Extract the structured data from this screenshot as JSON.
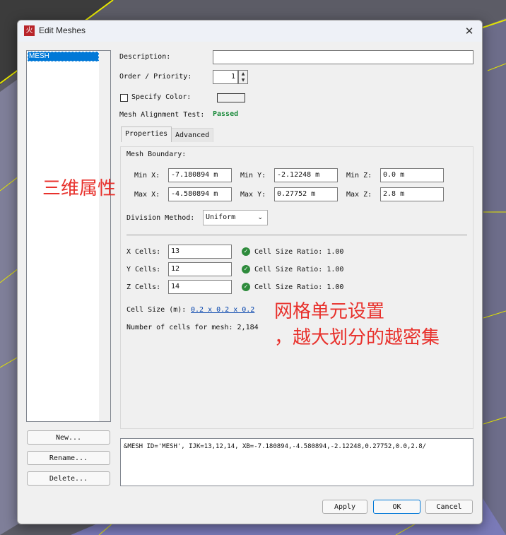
{
  "window": {
    "title": "Edit Meshes",
    "close_icon": "close-icon"
  },
  "mesh_list": {
    "items": [
      "MESH"
    ]
  },
  "left_buttons": {
    "new": "New...",
    "rename": "Rename...",
    "delete": "Delete..."
  },
  "form": {
    "description_label": "Description:",
    "description_value": "",
    "order_label": "Order / Priority:",
    "order_value": "1",
    "specify_color_label": "Specify Color:",
    "specify_color_checked": false,
    "alignment_label": "Mesh Alignment Test:",
    "alignment_value": "Passed"
  },
  "tabs": {
    "properties": "Properties",
    "advanced": "Advanced",
    "active": "Properties"
  },
  "boundary": {
    "heading": "Mesh Boundary:",
    "min_x_label": "Min X:",
    "min_x": "-7.180894 m",
    "min_y_label": "Min Y:",
    "min_y": "-2.12248 m",
    "min_z_label": "Min Z:",
    "min_z": "0.0 m",
    "max_x_label": "Max X:",
    "max_x": "-4.580894 m",
    "max_y_label": "Max Y:",
    "max_y": "0.27752 m",
    "max_z_label": "Max Z:",
    "max_z": "2.8 m"
  },
  "division": {
    "label": "Division Method:",
    "value": "Uniform"
  },
  "cells": {
    "x_label": "X Cells:",
    "x": "13",
    "x_ratio": "Cell Size Ratio: 1.00",
    "y_label": "Y Cells:",
    "y": "12",
    "y_ratio": "Cell Size Ratio: 1.00",
    "z_label": "Z Cells:",
    "z": "14",
    "z_ratio": "Cell Size Ratio: 1.00",
    "cell_size_label": "Cell Size (m):",
    "cell_size_value": "0.2 x 0.2 x 0.2",
    "count_text": "Number of cells for mesh: 2,184"
  },
  "fds_text": "&MESH ID='MESH', IJK=13,12,14, XB=-7.180894,-4.580894,-2.12248,0.27752,0.0,2.8/",
  "footer": {
    "apply": "Apply",
    "ok": "OK",
    "cancel": "Cancel"
  },
  "annotations": {
    "left": "三维属性",
    "right_line1": "网格单元设置",
    "right_line2": "，越大划分的越密集"
  },
  "colors": {
    "annotation": "#e8312c",
    "passed": "#1a8a3a",
    "selection": "#0078d7"
  }
}
